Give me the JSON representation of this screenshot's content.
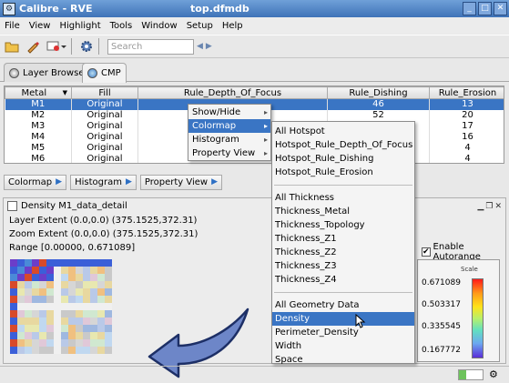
{
  "window": {
    "app_title": "Calibre - RVE",
    "doc_title": "top.dfmdb"
  },
  "menu": [
    "File",
    "View",
    "Highlight",
    "Tools",
    "Window",
    "Setup",
    "Help"
  ],
  "toolbar": {
    "search_placeholder": "Search"
  },
  "tabs": [
    {
      "label": "Layer Browser"
    },
    {
      "label": "CMP"
    }
  ],
  "table": {
    "headers": [
      "Metal",
      "Fill",
      "Rule_Depth_Of_Focus",
      "Rule_Dishing",
      "Rule_Erosion"
    ],
    "rows": [
      [
        "M1",
        "Original",
        "",
        "46",
        "13"
      ],
      [
        "M2",
        "Original",
        "",
        "52",
        "20"
      ],
      [
        "M3",
        "Original",
        "",
        "",
        "17"
      ],
      [
        "M4",
        "Original",
        "",
        "",
        "16"
      ],
      [
        "M5",
        "Original",
        "",
        "",
        "4"
      ],
      [
        "M6",
        "Original",
        "",
        "",
        "4"
      ]
    ],
    "selected_row": 0
  },
  "column_buttons": [
    "Colormap",
    "Histogram",
    "Property View"
  ],
  "detail": {
    "title": "Density M1_data_detail",
    "layer_extent": "Layer Extent (0.0,0.0) (375.1525,372.31)",
    "zoom_extent": "Zoom Extent (0.0,0.0) (375.1525,372.31)",
    "range": "Range [0.00000, 0.671089]",
    "autorange_label": "Enable Autorange",
    "autorange_checked": true
  },
  "scale": {
    "title": "Scale",
    "ticks": [
      "0.671089",
      "0.503317",
      "0.335545",
      "0.167772"
    ]
  },
  "context_menu": {
    "items": [
      "Show/Hide",
      "Colormap",
      "Histogram",
      "Property View"
    ],
    "highlighted": "Colormap"
  },
  "submenu": {
    "groups": [
      [
        "All Hotspot",
        "Hotspot_Rule_Depth_Of_Focus",
        "Hotspot_Rule_Dishing",
        "Hotspot_Rule_Erosion"
      ],
      [
        "All Thickness",
        "Thickness_Metal",
        "Thickness_Topology",
        "Thickness_Z1",
        "Thickness_Z2",
        "Thickness_Z3",
        "Thickness_Z4"
      ],
      [
        "All Geometry Data",
        "Density",
        "Perimeter_Density",
        "Width",
        "Space"
      ]
    ],
    "highlighted": "Density"
  },
  "colors": {
    "selection": "#3a75c4",
    "titlebar": "#3f73b8"
  }
}
